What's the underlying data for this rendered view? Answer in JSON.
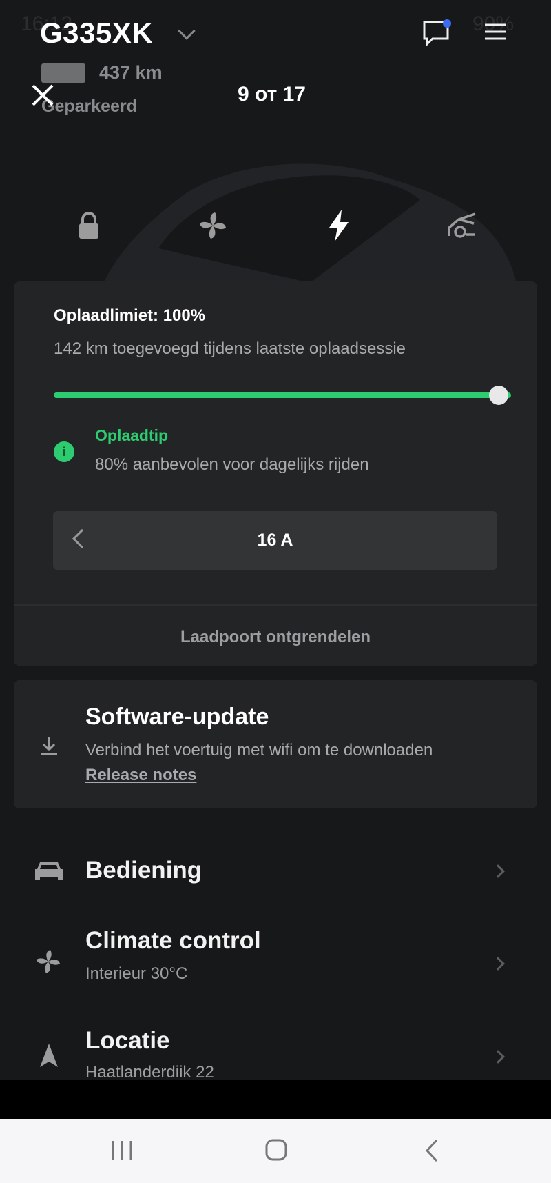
{
  "status_bar": {
    "time": "16:12",
    "battery": "90%"
  },
  "header": {
    "vehicle_name": "G335XK",
    "range": "437 km",
    "state": "Geparkeerd",
    "viewer_counter": "9 от 17"
  },
  "quick_controls": [
    {
      "icon": "lock-icon"
    },
    {
      "icon": "fan-icon"
    },
    {
      "icon": "bolt-icon",
      "active": true
    },
    {
      "icon": "trunk-icon"
    }
  ],
  "charging": {
    "limit_label": "Oplaadlimiet: 100%",
    "limit_percent": 100,
    "added_text": "142 km toegevoegd tijdens laatste oplaadsessie",
    "tip_title": "Oplaadtip",
    "tip_text": "80% aanbevolen voor dagelijks rijden",
    "current": "16 A",
    "unlock_port": "Laadpoort ontgrendelen",
    "accent": "#2ecc71"
  },
  "software": {
    "title": "Software-update",
    "text": "Verbind het voertuig met wifi om te downloaden",
    "link": "Release notes"
  },
  "menu": [
    {
      "title": "Bediening",
      "icon": "car-icon"
    },
    {
      "title": "Climate control",
      "sub": "Interieur 30°C",
      "icon": "fan-icon"
    },
    {
      "title": "Locatie",
      "sub": "Haatlanderdiik 22",
      "icon": "location-arrow-icon"
    }
  ]
}
